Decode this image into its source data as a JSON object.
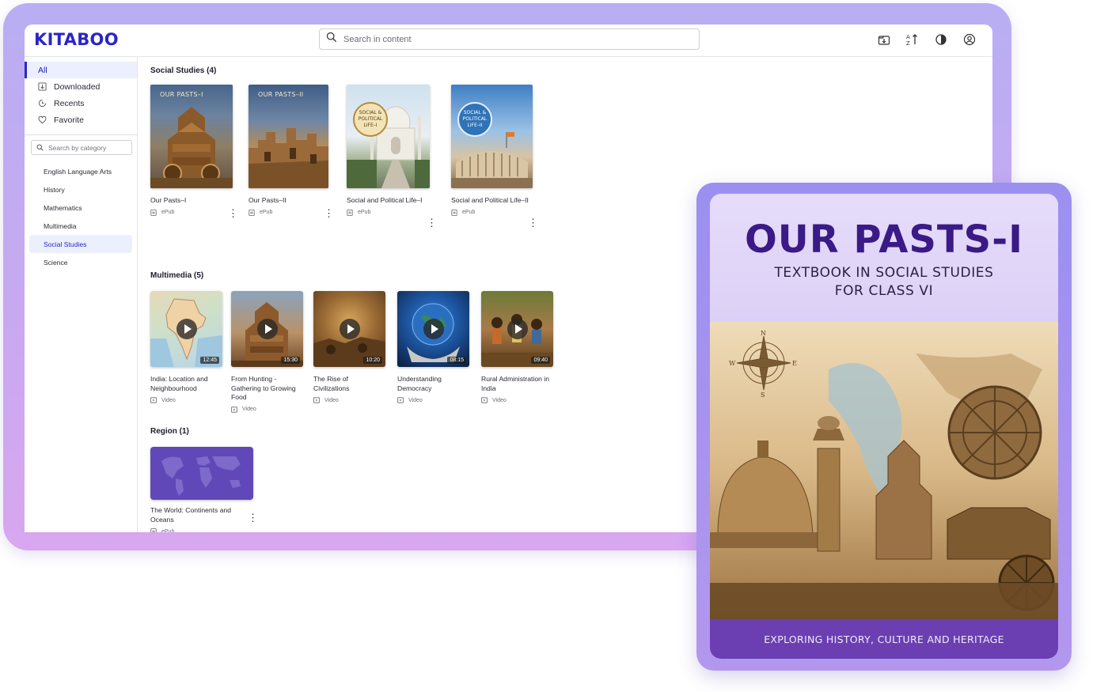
{
  "app": {
    "logo": "KITABOO"
  },
  "search": {
    "placeholder": "Search in content"
  },
  "header_icons": [
    "download-icon",
    "sort-icon",
    "contrast-icon",
    "profile-icon"
  ],
  "sidebar": {
    "items": [
      {
        "label": "All",
        "icon": "",
        "active": true
      },
      {
        "label": "Downloaded",
        "icon": "download-icon"
      },
      {
        "label": "Recents",
        "icon": "recent-icon"
      },
      {
        "label": "Favorite",
        "icon": "heart-icon"
      }
    ],
    "category_search_placeholder": "Search by category",
    "categories": [
      "English Language Arts",
      "History",
      "Mathematics",
      "Multimedia",
      "Social Studies",
      "Science"
    ],
    "active_category": "Social Studies"
  },
  "sections": {
    "social": {
      "title": "Social Studies (4)",
      "items": [
        {
          "title": "Our Pasts–I",
          "cover_text": "OUR PASTS–I",
          "type": "ePub"
        },
        {
          "title": "Our Pasts–II",
          "cover_text": "OUR PASTS–II",
          "type": "ePub"
        },
        {
          "title": "Social and Political Life–I",
          "seal": "SOCIAL & POLITICAL LIFE–I",
          "type": "ePub"
        },
        {
          "title": "Social and Political Life–II",
          "seal": "SOCIAL & POLITICAL LIFE–II",
          "type": "ePub"
        }
      ]
    },
    "multimedia": {
      "title": "Multimedia (5)",
      "items": [
        {
          "title": "India: Location and Neighbourhood",
          "duration": "12:45",
          "type": "Video"
        },
        {
          "title": "From Hunting - Gathering to Growing Food",
          "duration": "15:30",
          "type": "Video"
        },
        {
          "title": "The Rise of Civilizations",
          "duration": "10:20",
          "type": "Video"
        },
        {
          "title": "Understanding Democracy",
          "duration": "08:15",
          "type": "Video"
        },
        {
          "title": "Rural Administration in India",
          "duration": "09:40",
          "type": "Video"
        }
      ]
    },
    "region": {
      "title": "Region (1)",
      "items": [
        {
          "title": "The World: Continents and Oceans",
          "type": "ePub"
        }
      ]
    }
  },
  "book": {
    "title": "OUR  PASTS-I",
    "subtitle_1": "TEXTBOOK IN SOCIAL STUDIES",
    "subtitle_2": "FOR CLASS VI",
    "footer": "EXPLORING HISTORY, CULTURE AND HERITAGE",
    "compass": {
      "n": "N",
      "s": "S",
      "e": "E",
      "w": "W"
    }
  },
  "colors": {
    "brand": "#2a25c9",
    "frame": "#c3aaf1",
    "book_title": "#3a1a86",
    "book_footer": "#6b3fb2"
  }
}
